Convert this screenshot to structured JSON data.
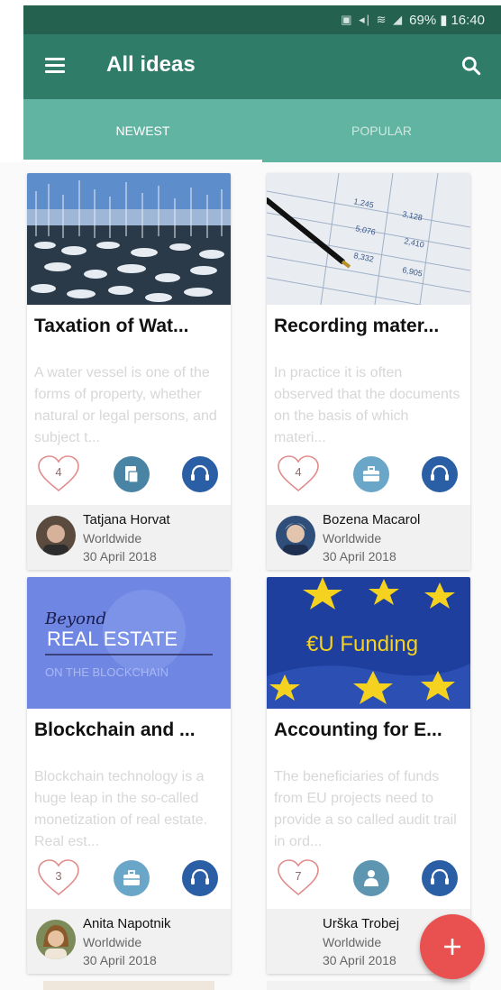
{
  "status": {
    "battery": "69%",
    "time": "16:40"
  },
  "appbar": {
    "title": "All ideas"
  },
  "tabs": [
    {
      "label": "NEWEST"
    },
    {
      "label": "POPULAR"
    }
  ],
  "cards": [
    {
      "title": "Taxation of Wat...",
      "excerpt": "A water vessel is one of the forms of property, whether natural or legal persons, and subject t...",
      "likes": "4",
      "category_icon": "document-icon",
      "author": "Tatjana Horvat",
      "location": "Worldwide",
      "date": "30 April 2018"
    },
    {
      "title": "Recording mater...",
      "excerpt": "In practice it is often observed that the documents on the basis of which materi...",
      "likes": "4",
      "category_icon": "briefcase-icon",
      "author": "Bozena Macarol",
      "location": "Worldwide",
      "date": "30 April 2018"
    },
    {
      "title": "Blockchain and ...",
      "excerpt": "Blockchain technology is a huge leap in the so-called monetization of real estate. Real est...",
      "likes": "3",
      "category_icon": "briefcase-icon",
      "author": "Anita Napotnik",
      "location": "Worldwide",
      "date": "30 April 2018",
      "image_text": {
        "line1": "Beyond",
        "line2": "REAL ESTATE",
        "line3": "ON THE BLOCKCHAIN"
      }
    },
    {
      "title": "Accounting for E...",
      "excerpt": "The beneficiaries of funds from EU projects need to provide a so called audit trail in ord...",
      "likes": "7",
      "category_icon": "people-icon",
      "author": "Urška Trobej",
      "location": "Worldwide",
      "date": "30 April 2018",
      "image_text": {
        "line1": "€U Funding"
      }
    }
  ],
  "colors": {
    "statusbar": "#24614f",
    "appbar": "#2f7d69",
    "tabs": "#61b3a2",
    "fab": "#e8514f"
  }
}
